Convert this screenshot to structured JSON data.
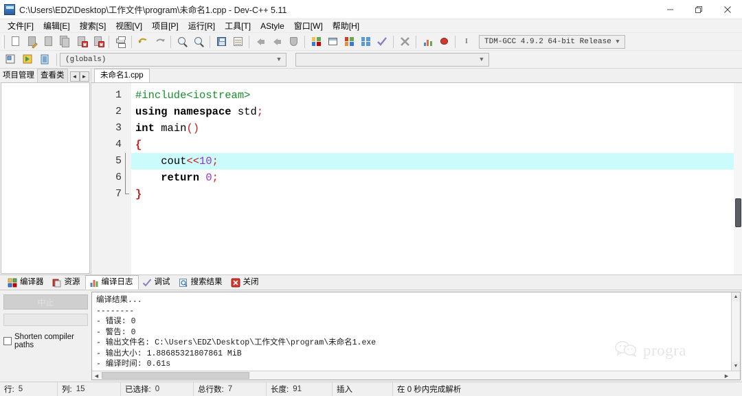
{
  "window": {
    "title": "C:\\Users\\EDZ\\Desktop\\工作文件\\program\\未命名1.cpp - Dev-C++ 5.11",
    "minimize_label": "minimize",
    "restore_label": "restore",
    "close_label": "close"
  },
  "menu": {
    "items": [
      {
        "label": "文件[F]"
      },
      {
        "label": "编辑[E]"
      },
      {
        "label": "搜索[S]"
      },
      {
        "label": "视图[V]"
      },
      {
        "label": "项目[P]"
      },
      {
        "label": "运行[R]"
      },
      {
        "label": "工具[T]"
      },
      {
        "label": "AStyle"
      },
      {
        "label": "窗口[W]"
      },
      {
        "label": "帮助[H]"
      }
    ]
  },
  "toolbar": {
    "compiler_set": {
      "value": "TDM-GCC 4.9.2 64-bit Release",
      "arrow": "▼"
    },
    "scope_combo": {
      "value": "(globals)",
      "arrow": "▼"
    },
    "member_combo": {
      "value": "",
      "arrow": "▼"
    }
  },
  "left_panel": {
    "tabs": [
      {
        "label": "项目管理",
        "selected": false
      },
      {
        "label": "查看类",
        "selected": true
      }
    ],
    "spin_prev": "◄",
    "spin_next": "►"
  },
  "editor": {
    "tab_label": "未命名1.cpp",
    "lines": [
      {
        "num": "1",
        "tokens": [
          {
            "t": "#include<iostream>",
            "c": "tk-pre"
          }
        ]
      },
      {
        "num": "2",
        "tokens": [
          {
            "t": "using",
            "c": "tk-kw"
          },
          {
            "t": " ",
            "c": "tk-id"
          },
          {
            "t": "namespace",
            "c": "tk-kw"
          },
          {
            "t": " ",
            "c": "tk-id"
          },
          {
            "t": "std",
            "c": "tk-id"
          },
          {
            "t": ";",
            "c": "tk-sym"
          }
        ]
      },
      {
        "num": "3",
        "tokens": [
          {
            "t": "int",
            "c": "tk-kw"
          },
          {
            "t": " ",
            "c": "tk-id"
          },
          {
            "t": "main",
            "c": "tk-id"
          },
          {
            "t": "()",
            "c": "tk-sym"
          }
        ]
      },
      {
        "num": "4",
        "tokens": [
          {
            "t": "{",
            "c": "tk-brace"
          }
        ]
      },
      {
        "num": "5",
        "tokens": [
          {
            "t": "    ",
            "c": "tk-id"
          },
          {
            "t": "cout",
            "c": "tk-id"
          },
          {
            "t": "<<",
            "c": "tk-sym"
          },
          {
            "t": "10",
            "c": "tk-num"
          },
          {
            "t": ";",
            "c": "tk-sym"
          }
        ]
      },
      {
        "num": "6",
        "tokens": [
          {
            "t": "    ",
            "c": "tk-id"
          },
          {
            "t": "return",
            "c": "tk-kw"
          },
          {
            "t": " ",
            "c": "tk-id"
          },
          {
            "t": "0",
            "c": "tk-num"
          },
          {
            "t": ";",
            "c": "tk-sym"
          }
        ]
      },
      {
        "num": "7",
        "tokens": [
          {
            "t": "}",
            "c": "tk-brace"
          }
        ]
      }
    ],
    "current_line": 5,
    "fold_line": 4
  },
  "bottom_panel": {
    "tabs": [
      {
        "label": "编译器",
        "icon": "grid-icon",
        "selected": false
      },
      {
        "label": "资源",
        "icon": "resource-icon",
        "selected": false
      },
      {
        "label": "编译日志",
        "icon": "chart-icon",
        "selected": true
      },
      {
        "label": "调试",
        "icon": "check-icon",
        "selected": false
      },
      {
        "label": "搜索结果",
        "icon": "find-icon",
        "selected": false
      },
      {
        "label": "关闭",
        "icon": "close-red-icon",
        "selected": false
      }
    ],
    "abort_button": "中止",
    "shorten_paths_label": "Shorten compiler paths",
    "log": "编译结果...\n--------\n- 错误: 0\n- 警告: 0\n- 输出文件名: C:\\Users\\EDZ\\Desktop\\工作文件\\program\\未命名1.exe\n- 输出大小: 1.88685321807861 MiB\n- 编译时间: 0.61s"
  },
  "watermark": {
    "text": "progra",
    "icon": "wechat-icon"
  },
  "statusbar": {
    "cells": [
      {
        "key": "行:",
        "value": "5"
      },
      {
        "key": "列:",
        "value": "15"
      },
      {
        "key": "已选择:",
        "value": "0"
      },
      {
        "key": "总行数:",
        "value": "7"
      },
      {
        "key": "长度:",
        "value": "91"
      },
      {
        "key": "插入",
        "value": ""
      },
      {
        "key": "在 0 秒内完成解析",
        "value": ""
      }
    ]
  },
  "colors": {
    "current_line": "#ccfbfb",
    "preprocessor": "#1a8f2d",
    "symbol": "#c81b1b",
    "number": "#9b30d0",
    "chrome": "#f0f0f0"
  }
}
